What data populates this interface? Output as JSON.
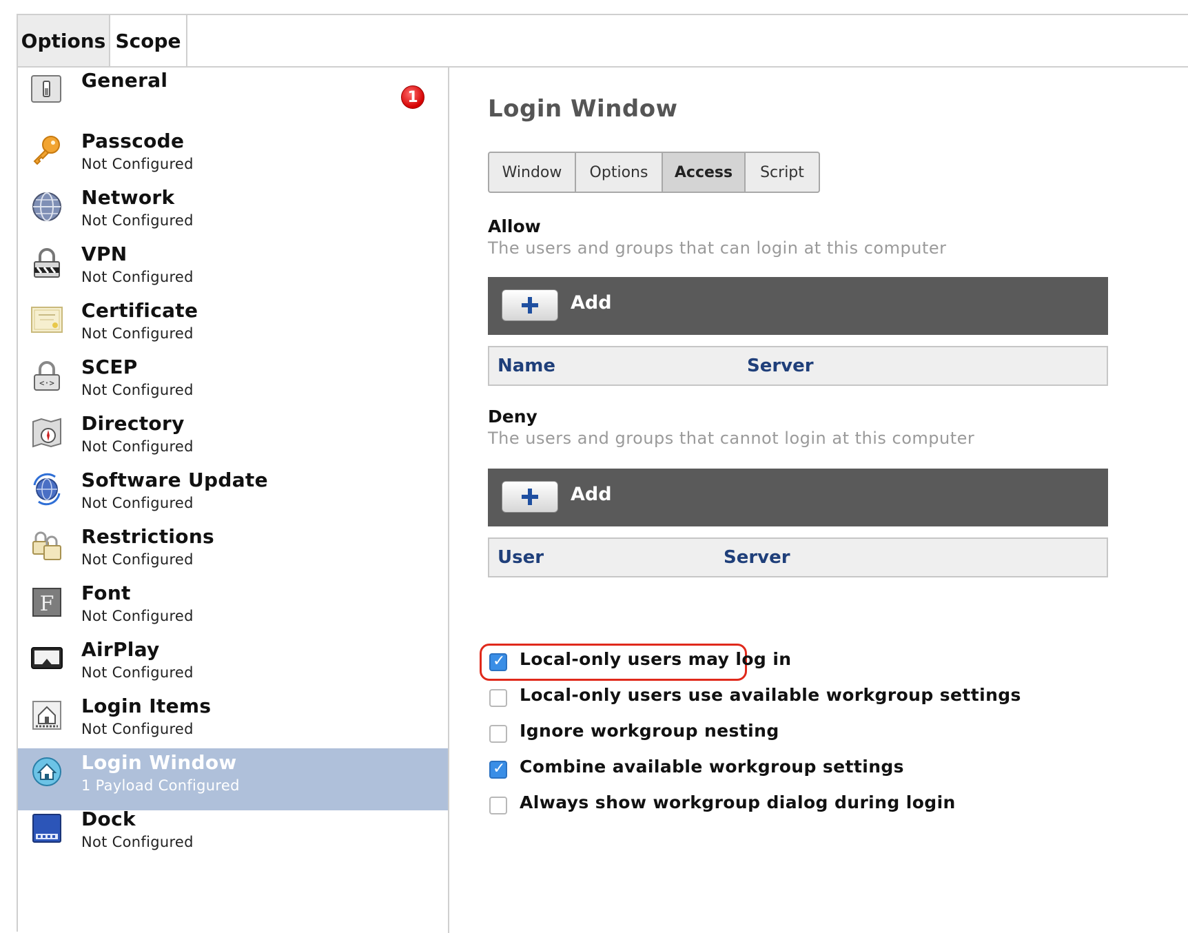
{
  "top_tabs": [
    {
      "label": "Options",
      "active": true
    },
    {
      "label": "Scope",
      "active": false
    }
  ],
  "sidebar": {
    "items": [
      {
        "title": "General",
        "subtitle": "",
        "icon": "switch-icon",
        "badge": "1"
      },
      {
        "title": "Passcode",
        "subtitle": "Not Configured",
        "icon": "key-icon"
      },
      {
        "title": "Network",
        "subtitle": "Not Configured",
        "icon": "globe-icon"
      },
      {
        "title": "VPN",
        "subtitle": "Not Configured",
        "icon": "vpn-lock-icon"
      },
      {
        "title": "Certificate",
        "subtitle": "Not Configured",
        "icon": "certificate-icon"
      },
      {
        "title": "SCEP",
        "subtitle": "Not Configured",
        "icon": "scep-lock-icon"
      },
      {
        "title": "Directory",
        "subtitle": "Not Configured",
        "icon": "directory-icon"
      },
      {
        "title": "Software Update",
        "subtitle": "Not Configured",
        "icon": "software-update-icon"
      },
      {
        "title": "Restrictions",
        "subtitle": "Not Configured",
        "icon": "restrictions-icon"
      },
      {
        "title": "Font",
        "subtitle": "Not Configured",
        "icon": "font-icon"
      },
      {
        "title": "AirPlay",
        "subtitle": "Not Configured",
        "icon": "airplay-icon"
      },
      {
        "title": "Login Items",
        "subtitle": "Not Configured",
        "icon": "login-items-icon"
      },
      {
        "title": "Login Window",
        "subtitle": "1 Payload Configured",
        "icon": "login-window-icon",
        "selected": true
      },
      {
        "title": "Dock",
        "subtitle": "Not Configured",
        "icon": "dock-icon"
      }
    ]
  },
  "main": {
    "title": "Login Window",
    "segments": [
      {
        "label": "Window",
        "active": false
      },
      {
        "label": "Options",
        "active": false
      },
      {
        "label": "Access",
        "active": true
      },
      {
        "label": "Script",
        "active": false
      }
    ],
    "allow": {
      "title": "Allow",
      "description": "The users and groups that can login at this computer",
      "add_label": "Add",
      "columns": [
        "Name",
        "Server"
      ]
    },
    "deny": {
      "title": "Deny",
      "description": "The users and groups that cannot login at this computer",
      "add_label": "Add",
      "columns": [
        "User",
        "Server"
      ]
    },
    "checkboxes": [
      {
        "label": "Local-only users may log in",
        "checked": true
      },
      {
        "label": "Local-only users use available workgroup settings",
        "checked": false
      },
      {
        "label": "Ignore workgroup nesting",
        "checked": false
      },
      {
        "label": "Combine available workgroup settings",
        "checked": true
      },
      {
        "label": "Always show workgroup dialog during login",
        "checked": false
      }
    ]
  },
  "colors": {
    "selection": "#afc0da",
    "highlight": "#e0291b",
    "checkbox": "#3a8ee6",
    "column_header": "#1f3f7a",
    "add_bar": "#5a5a5a"
  }
}
